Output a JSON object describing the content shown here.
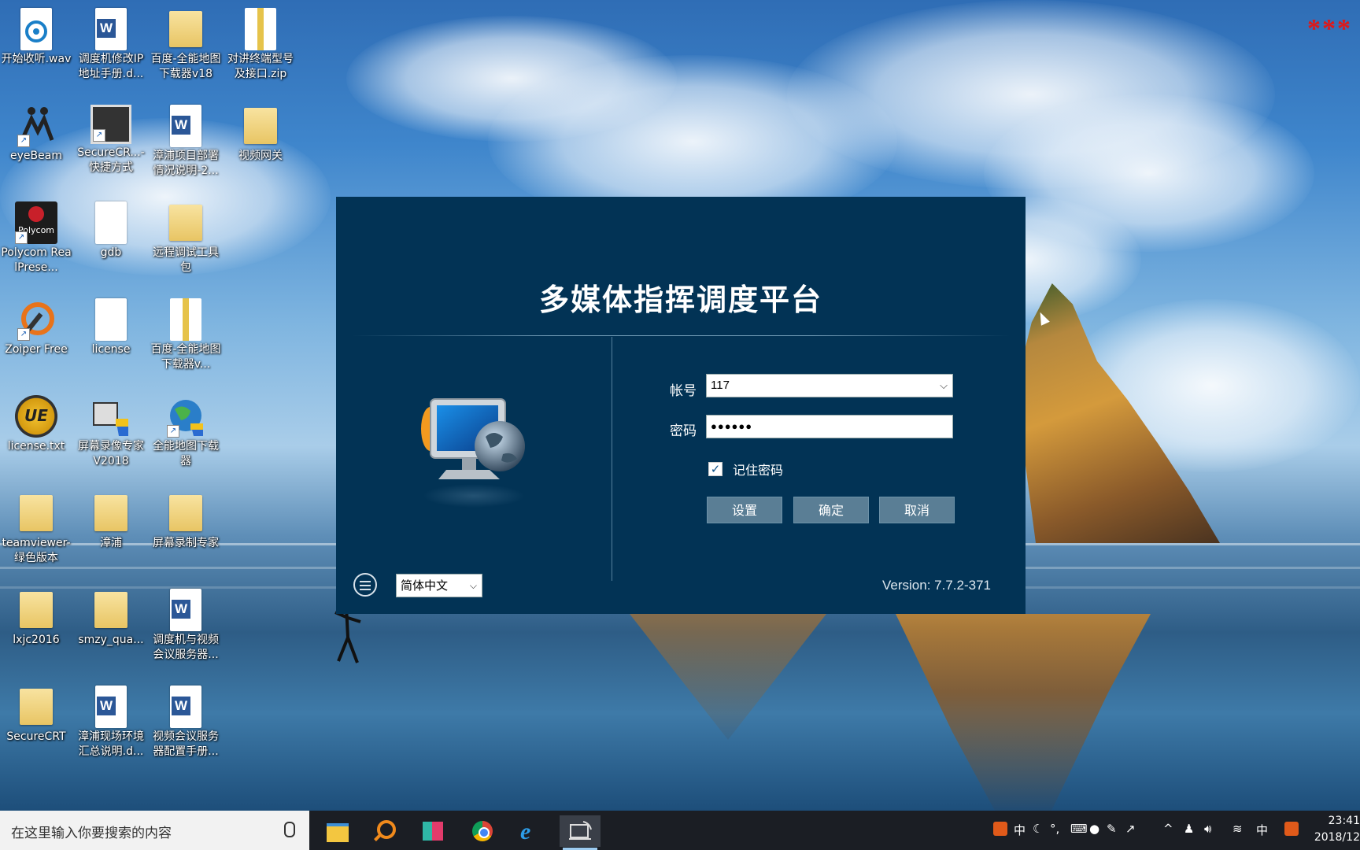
{
  "desktop": {
    "icons": [
      {
        "label": "开始收听.wav",
        "type": "audio"
      },
      {
        "label": "调度机修改IP地址手册.d...",
        "type": "word"
      },
      {
        "label": "百度-全能地图下载器v18",
        "type": "folder"
      },
      {
        "label": "对讲终端型号及接口.zip",
        "type": "zip"
      },
      {
        "label": "eyeBeam",
        "type": "app"
      },
      {
        "label": "SecureCR...- 快捷方式",
        "type": "app"
      },
      {
        "label": "漳浦项目部署情况说明-2...",
        "type": "word"
      },
      {
        "label": "视频网关",
        "type": "folder"
      },
      {
        "label": "Polycom RealPrese...",
        "type": "app"
      },
      {
        "label": "gdb",
        "type": "file"
      },
      {
        "label": "远程调试工具包",
        "type": "folder"
      },
      {
        "label": "Zoiper Free",
        "type": "app"
      },
      {
        "label": "license",
        "type": "file"
      },
      {
        "label": "百度-全能地图下载器v...",
        "type": "zip"
      },
      {
        "label": "license.txt",
        "type": "app"
      },
      {
        "label": "屏幕录像专家V2018",
        "type": "app"
      },
      {
        "label": "全能地图下载器",
        "type": "app"
      },
      {
        "label": "teamviewer-绿色版本",
        "type": "folder"
      },
      {
        "label": "漳浦",
        "type": "folder"
      },
      {
        "label": "屏幕录制专家",
        "type": "folder"
      },
      {
        "label": "lxjc2016",
        "type": "folder"
      },
      {
        "label": "smzy_qua...",
        "type": "folder"
      },
      {
        "label": "调度机与视频会议服务器...",
        "type": "word"
      },
      {
        "label": "SecureCRT",
        "type": "folder"
      },
      {
        "label": "漳浦现场环境汇总说明.d...",
        "type": "word"
      },
      {
        "label": "视频会议服务器配置手册...",
        "type": "word"
      }
    ],
    "corner_mark": "***",
    "polycom_text": "Polycom"
  },
  "dialog": {
    "title": "多媒体指挥调度平台",
    "account_label": "帐号",
    "account_value": "117",
    "password_label": "密码",
    "password_value": "●●●●●●",
    "remember_label": "记住密码",
    "remember_checked": true,
    "buttons": {
      "settings": "设置",
      "ok": "确定",
      "cancel": "取消"
    },
    "language": "简体中文",
    "version": "Version: 7.7.2-371"
  },
  "taskbar": {
    "search_placeholder": "在这里输入你要搜索的内容",
    "apps": [
      "file-explorer",
      "search-tool",
      "store",
      "chrome",
      "internet-explorer",
      "dispatch-client"
    ],
    "tray": {
      "ime1": "中",
      "ime2": "中",
      "degree": "°,"
    },
    "clock": {
      "time": "23:41",
      "date": "2018/12"
    }
  },
  "colors": {
    "dialog_bg": "#023355",
    "button_bg": "#5a7e95",
    "taskbar_bg": "#1b1e24"
  }
}
